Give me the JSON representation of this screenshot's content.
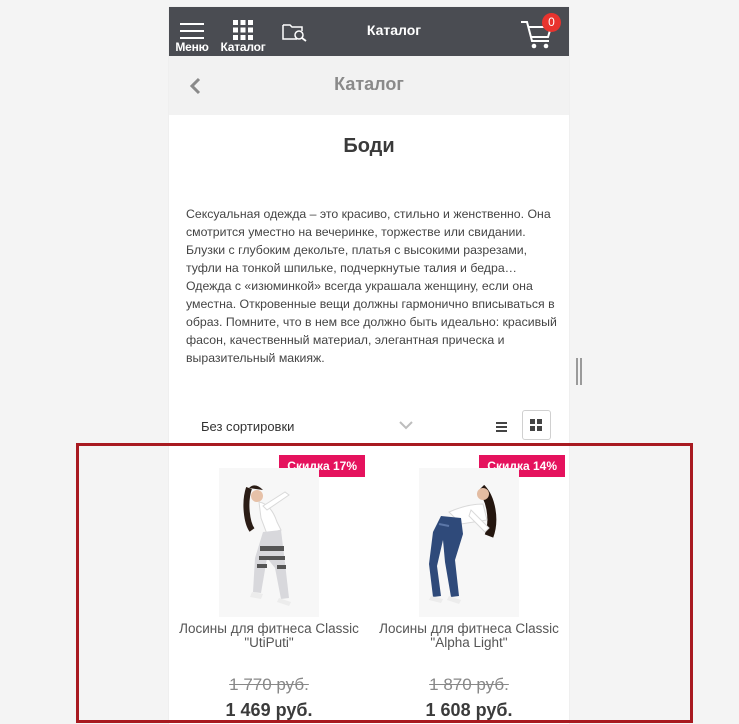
{
  "topbar": {
    "menu_label": "Меню",
    "catalog_label": "Каталог",
    "title": "Каталог",
    "cart_count": "0"
  },
  "subheader": {
    "title": "Каталог"
  },
  "page": {
    "title": "Боди",
    "description": "Сексуальная одежда – это красиво, стильно и женственно. Она смотрится уместно на вечеринке, торжестве или свидании. Блузки с глубоким декольте, платья с высокими разрезами, туфли на тонкой шпильке, подчеркнутые талия и бедра… Одежда с «изюминкой» всегда украшала женщину, если она уместна. Откровенные вещи должны гармонично вписываться в образ. Помните, что в нем все должно быть идеально: красивый фасон, качественный материал, элегантная прическа и выразительный макияж."
  },
  "sort": {
    "selected": "Без сортировки"
  },
  "products": [
    {
      "badge": "Скидка 17%",
      "name": "Лосины для фитнеса Classic \"UtiPuti\"",
      "old_price": "1 770 руб.",
      "new_price": "1 469 руб."
    },
    {
      "badge": "Скидка 14%",
      "name": "Лосины для фитнеса Classic \"Alpha Light\"",
      "old_price": "1 870 руб.",
      "new_price": "1 608 руб."
    }
  ],
  "colors": {
    "topbar_bg": "#4a4c52",
    "badge_bg": "#e5125d",
    "cart_badge_bg": "#e8332e",
    "highlight_border": "#a81a20"
  }
}
